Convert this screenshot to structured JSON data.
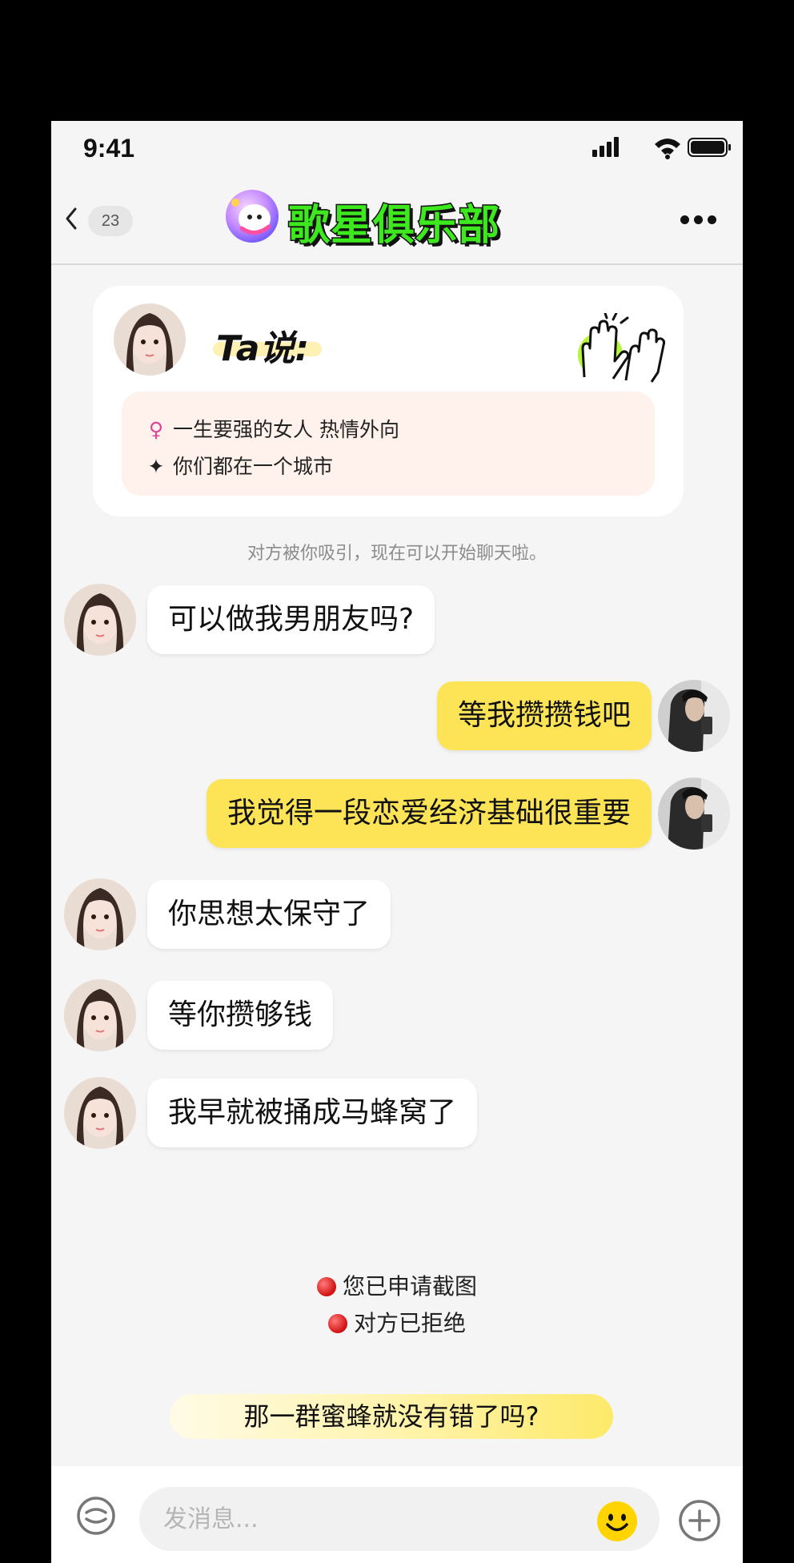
{
  "status_bar": {
    "time": "9:41"
  },
  "header": {
    "unread_count": "23",
    "title": "歌星俱乐部"
  },
  "profile_card": {
    "heading": "Ta说:",
    "tags": [
      {
        "icon": "female-icon",
        "text": "一生要强的女人   热情外向"
      },
      {
        "icon": "sparkle-icon",
        "text": "你们都在一个城市"
      }
    ]
  },
  "system_note": "对方被你吸引，现在可以开始聊天啦。",
  "messages": [
    {
      "side": "left",
      "text": "可以做我男朋友吗?"
    },
    {
      "side": "right",
      "text": "等我攒攒钱吧"
    },
    {
      "side": "right",
      "text": "我觉得一段恋爱经济基础很重要"
    },
    {
      "side": "left",
      "text": "你思想太保守了"
    },
    {
      "side": "left",
      "text": "等你攒够钱"
    },
    {
      "side": "left",
      "text": "我早就被捅成马蜂窝了"
    }
  ],
  "notices": [
    {
      "icon": "red-dot-icon",
      "text": "您已申请截图"
    },
    {
      "icon": "red-dot-icon",
      "text": "对方已拒绝"
    }
  ],
  "hint": "那一群蜜蜂就没有错了吗?",
  "input": {
    "placeholder": "发消息..."
  },
  "colors": {
    "outgoing_bubble": "#fde456",
    "incoming_bubble": "#ffffff",
    "title_green": "#3ee81f",
    "background": "#f5f5f5"
  }
}
